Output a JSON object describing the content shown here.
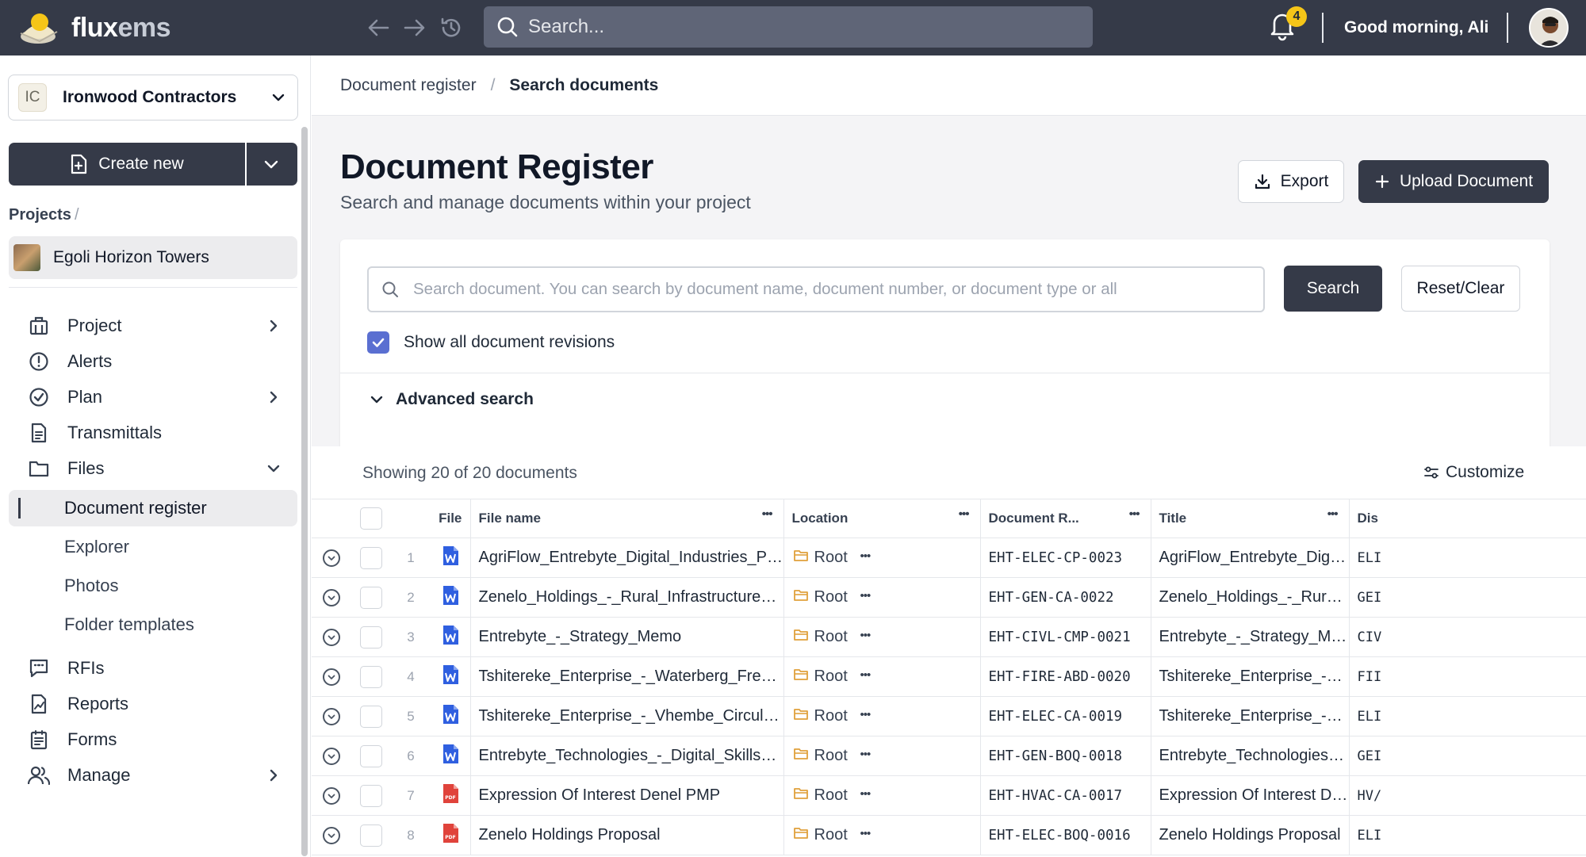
{
  "app": {
    "logo_text": "flux",
    "logo_text_accent": "ems",
    "search_placeholder": "Search...",
    "notification_count": "4",
    "greeting": "Good morning, Ali"
  },
  "sidebar": {
    "org_badge": "IC",
    "org_name": "Ironwood Contractors",
    "create_new_label": "Create new",
    "projects_label": "Projects",
    "projects_sep": "/",
    "project_name": "Egoli Horizon Towers",
    "menu": [
      {
        "label": "Project",
        "icon": "building-icon",
        "chevron": "right"
      },
      {
        "label": "Alerts",
        "icon": "alert-circle-icon"
      },
      {
        "label": "Plan",
        "icon": "check-circle-icon",
        "chevron": "right"
      },
      {
        "label": "Transmittals",
        "icon": "document-icon"
      },
      {
        "label": "Files",
        "icon": "folder-icon",
        "chevron": "down"
      },
      {
        "label": "RFIs",
        "icon": "chat-icon"
      },
      {
        "label": "Reports",
        "icon": "report-icon"
      },
      {
        "label": "Forms",
        "icon": "form-icon"
      },
      {
        "label": "Manage",
        "icon": "users-icon",
        "chevron": "right"
      }
    ],
    "files_sub": [
      "Document register",
      "Explorer",
      "Photos",
      "Folder templates"
    ],
    "active_sub": "Document register"
  },
  "breadcrumb": {
    "parent": "Document register",
    "separator": "/",
    "current": "Search documents"
  },
  "page": {
    "title": "Document Register",
    "subtitle": "Search and manage documents within your project",
    "export_label": "Export",
    "upload_label": "Upload Document"
  },
  "search": {
    "placeholder": "Search document. You can search by document name, document number, or document type or all",
    "search_button": "Search",
    "reset_button": "Reset/Clear",
    "show_revisions_label": "Show all document revisions",
    "show_revisions_checked": true,
    "advanced_label": "Advanced search"
  },
  "table": {
    "showing_text": "Showing 20 of 20 documents",
    "customize_label": "Customize",
    "headers": {
      "file": "File",
      "file_name": "File name",
      "location": "Location",
      "doc_ref": "Document R...",
      "title": "Title",
      "dis": "Dis"
    },
    "rows": [
      {
        "num": "1",
        "type": "word",
        "file_name": "AgriFlow_Entrebyte_Digital_Industries_Proposal",
        "location": "Root",
        "doc_ref": "EHT-ELEC-CP-0023",
        "title": "AgriFlow_Entrebyte_Digital_I...",
        "dis": "ELI"
      },
      {
        "num": "2",
        "type": "word",
        "file_name": "Zenelo_Holdings_-_Rural_Infrastructure_Mechan...",
        "location": "Root",
        "doc_ref": "EHT-GEN-CA-0022",
        "title": "Zenelo_Holdings_-_Rural_Inf...",
        "dis": "GEI"
      },
      {
        "num": "3",
        "type": "word",
        "file_name": "Entrebyte_-_Strategy_Memo",
        "location": "Root",
        "doc_ref": "EHT-CIVL-CMP-0021",
        "title": "Entrebyte_-_Strategy_Memo",
        "dis": "CIV"
      },
      {
        "num": "4",
        "type": "word",
        "file_name": "Tshitereke_Enterprise_-_Waterberg_Fresh_Harve...",
        "location": "Root",
        "doc_ref": "EHT-FIRE-ABD-0020",
        "title": "Tshitereke_Enterprise_-_Wat...",
        "dis": "FII"
      },
      {
        "num": "5",
        "type": "word",
        "file_name": "Tshitereke_Enterprise_-_Vhembe_Circular_Econ...",
        "location": "Root",
        "doc_ref": "EHT-ELEC-CA-0019",
        "title": "Tshitereke_Enterprise_-_Vhe...",
        "dis": "ELI"
      },
      {
        "num": "6",
        "type": "word",
        "file_name": "Entrebyte_Technologies_-_Digital_Skills_Academ...",
        "location": "Root",
        "doc_ref": "EHT-GEN-BOQ-0018",
        "title": "Entrebyte_Technologies_-_Di...",
        "dis": "GEI"
      },
      {
        "num": "7",
        "type": "pdf",
        "file_name": "Expression Of Interest Denel PMP",
        "location": "Root",
        "doc_ref": "EHT-HVAC-CA-0017",
        "title": "Expression Of Interest Denel...",
        "dis": "HV/"
      },
      {
        "num": "8",
        "type": "pdf",
        "file_name": "Zenelo Holdings Proposal",
        "location": "Root",
        "doc_ref": "EHT-ELEC-BOQ-0016",
        "title": "Zenelo Holdings Proposal",
        "dis": "ELI"
      }
    ]
  },
  "colors": {
    "topbar": "#353a48",
    "primary_button": "#353a48",
    "checkbox": "#5a6fd1",
    "word_icon": "#2f5fe0",
    "pdf_icon": "#e0433b",
    "folder_icon": "#e0a03b",
    "badge": "#f5c518"
  }
}
